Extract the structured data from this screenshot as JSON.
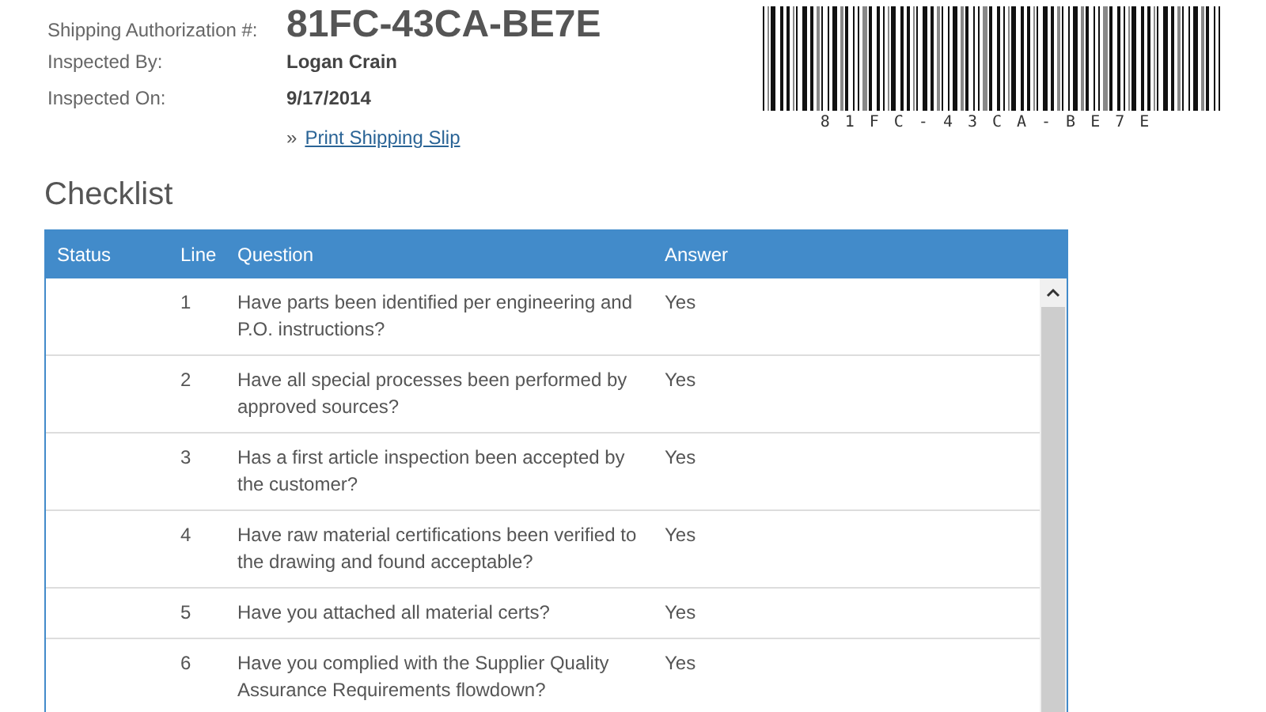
{
  "details": [
    {
      "label": "Shipping Authorization #:",
      "value": "81FC-43CA-BE7E",
      "kind": "code"
    },
    {
      "label": "Inspected By:",
      "value": "Logan Crain",
      "kind": "text"
    },
    {
      "label": "Inspected On:",
      "value": "9/17/2014",
      "kind": "text"
    }
  ],
  "print_link": {
    "prefix": "»",
    "label": "Print Shipping Slip"
  },
  "barcode": {
    "caption": "81FC-43CA-BE7E"
  },
  "checklist": {
    "title": "Checklist",
    "columns": [
      "Status",
      "Line",
      "Question",
      "Answer"
    ],
    "rows": [
      {
        "line": "1",
        "question": "Have parts been identified per engineering and P.O. instructions?",
        "answer": "Yes"
      },
      {
        "line": "2",
        "question": "Have all special processes been performed by approved sources?",
        "answer": "Yes"
      },
      {
        "line": "3",
        "question": "Has a first article inspection been accepted by the customer?",
        "answer": "Yes"
      },
      {
        "line": "4",
        "question": "Have raw material certifications been verified to the drawing and found acceptable?",
        "answer": "Yes"
      },
      {
        "line": "5",
        "question": "Have you attached all material certs?",
        "answer": "Yes"
      },
      {
        "line": "6",
        "question": "Have you complied with the Supplier Quality Assurance Requirements flowdown?",
        "answer": "Yes"
      }
    ]
  }
}
